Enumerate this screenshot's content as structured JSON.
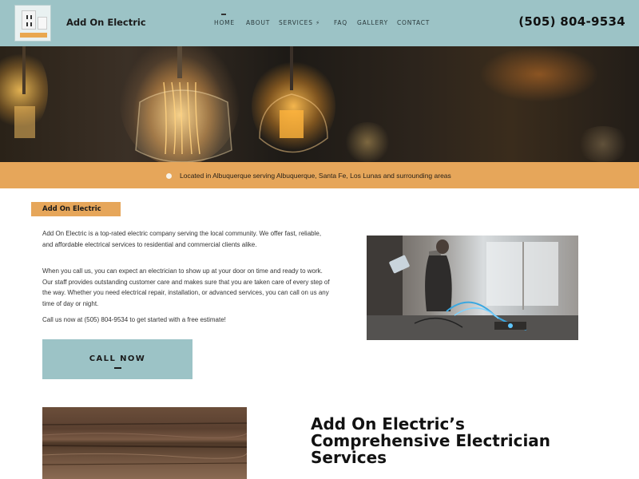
{
  "header": {
    "logo": "electrical-outlet-logo",
    "brand": "Add On Electric",
    "nav": [
      {
        "label": "HOME",
        "active": true
      },
      {
        "label": "ABOUT"
      },
      {
        "label": "SERVICES ⚡"
      },
      {
        "label": "FAQ"
      },
      {
        "label": "GALLERY"
      },
      {
        "label": "CONTACT"
      }
    ],
    "phone": "(505) 804-9534"
  },
  "banner": {
    "icon": "location-pin-icon",
    "text": "Located in Albuquerque serving Albuquerque, Santa Fe, Los Lunas and surrounding areas"
  },
  "intro": {
    "tag": "Add On Electric",
    "paragraphs": [
      "Add On Electric is a top-rated electric company serving the local community. We offer fast, reliable, and affordable electrical services to residential and commercial clients alike.",
      "When you call us, you can expect an electrician to show up at your door on time and ready to work. Our staff provides outstanding customer care and makes sure that you are taken care of every step of the way. Whether you need electrical repair, installation, or advanced services, you can call on us any time of day or night.",
      "Call us now at (505) 804-9534 to get started with a free estimate!"
    ],
    "cta": "CALL NOW"
  },
  "services": {
    "heading_lines": [
      "Add On Electric’s",
      "Comprehensive Electrician",
      "Services"
    ]
  },
  "colors": {
    "header_bg": "#9cc3c6",
    "accent_orange": "#e6a65a",
    "text_dark": "#121212"
  }
}
